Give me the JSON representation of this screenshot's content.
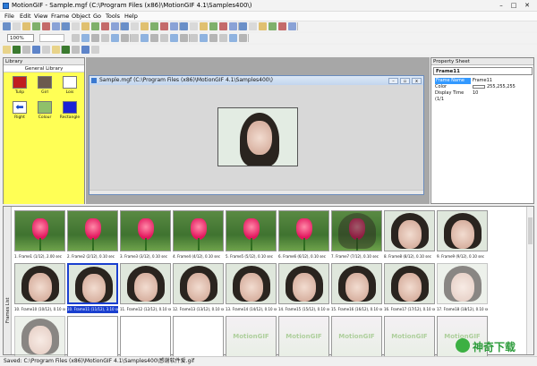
{
  "window": {
    "title": "MotionGIF - Sample.mgf (C:\\Program Files (x86)\\MotionGIF 4.1\\Samples400\\)"
  },
  "menu": [
    "File",
    "Edit",
    "View",
    "Frame",
    "Object",
    "Go",
    "Tools",
    "Help"
  ],
  "toolbar": {
    "zoom_value": "100%"
  },
  "library": {
    "title": "Library",
    "section": "General Library",
    "items": [
      "Tulip",
      "Girl",
      "Lois",
      "Right",
      "Colour",
      "Rectangle"
    ]
  },
  "document": {
    "title": "Sample.mgf (C:\\Program Files (x86)\\MotionGIF 4.1\\Samples400\\)"
  },
  "properties": {
    "title": "Property Sheet",
    "object": "Frame11",
    "rows": [
      {
        "key": "Frame Name",
        "value": "Frame11"
      },
      {
        "key": "Color",
        "value": "255,255,255"
      },
      {
        "key": "Display Time (1/1",
        "value": "10"
      }
    ]
  },
  "frames_panel": {
    "label": "Frames List"
  },
  "frames": [
    {
      "caption": "1. Frame1 (1/12), 2.00 sec",
      "type": "tulip"
    },
    {
      "caption": "2. Frame2 (2/12), 0.10 sec",
      "type": "tulip"
    },
    {
      "caption": "3. Frame3 (3/12), 0.10 sec",
      "type": "tulip"
    },
    {
      "caption": "4. Frame4 (4/12), 0.10 sec",
      "type": "tulip"
    },
    {
      "caption": "5. Frame5 (5/12), 0.10 sec",
      "type": "tulip"
    },
    {
      "caption": "6. Frame6 (6/12), 0.10 sec",
      "type": "tulip"
    },
    {
      "caption": "7. Frame7 (7/12), 0.10 sec",
      "type": "mix"
    },
    {
      "caption": "8. Frame8 (8/12), 0.10 sec",
      "type": "girl"
    },
    {
      "caption": "9. Frame9 (9/12), 0.10 sec",
      "type": "girl"
    },
    {
      "caption": "10. Frame10 (10/12), 0.10 sec",
      "type": "girl"
    },
    {
      "caption": "10. Frame11 (11/12), 3.10 sec",
      "type": "girl",
      "selected": true
    },
    {
      "caption": "11. Frame12 (12/12), 0.10 sec",
      "type": "girl"
    },
    {
      "caption": "12. Frame13 (13/12), 0.10 sec",
      "type": "girl"
    },
    {
      "caption": "13. Frame14 (14/12), 0.10 sec",
      "type": "girl"
    },
    {
      "caption": "14. Frame15 (15/12), 0.10 sec",
      "type": "girl"
    },
    {
      "caption": "15. Frame16 (16/12), 0.10 sec",
      "type": "girl"
    },
    {
      "caption": "16. Frame17 (17/12), 0.10 sec",
      "type": "girl"
    },
    {
      "caption": "17. Frame18 (18/12), 0.10 sec",
      "type": "fade"
    },
    {
      "caption": "18. Frame19 (19/12), 0.10 sec",
      "type": "fade"
    },
    {
      "caption": "",
      "type": "blank"
    },
    {
      "caption": "",
      "type": "blank"
    },
    {
      "caption": "",
      "type": "blank"
    },
    {
      "caption": "",
      "type": "wm"
    },
    {
      "caption": "",
      "type": "wm"
    },
    {
      "caption": "",
      "type": "wm"
    },
    {
      "caption": "",
      "type": "wm"
    },
    {
      "caption": "",
      "type": "wm"
    },
    {
      "caption": "",
      "type": "wm"
    }
  ],
  "watermark_text": "MotionGIF",
  "status": "Saved: C:\\Program Files (x86)\\MotionGIF 4.1\\Samples400\\感谢软件爱.gif",
  "brand_text": "神奇下载",
  "colors": {
    "library_bg": "#ffff55",
    "selection": "#1a3fcf",
    "accent": "#3399ff"
  }
}
